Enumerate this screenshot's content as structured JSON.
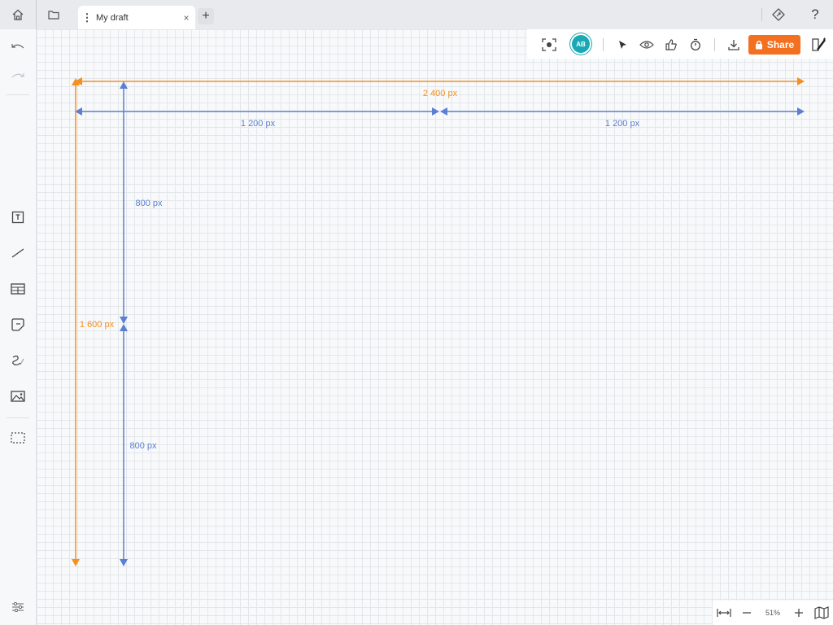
{
  "tab": {
    "title": "My draft"
  },
  "toolbar": {
    "share_label": "Share",
    "avatar_initials": "AB"
  },
  "zoom": {
    "level": "51%"
  },
  "dimensions": {
    "total_width": "2 400 px",
    "half_width_left": "1 200 px",
    "half_width_right": "1 200 px",
    "total_height": "1 600 px",
    "half_height_top": "800 px",
    "half_height_bottom": "800 px"
  },
  "colors": {
    "orange": "#f5901e",
    "blue": "#5b7fd4",
    "share": "#f37021",
    "avatar": "#18a9b5"
  }
}
